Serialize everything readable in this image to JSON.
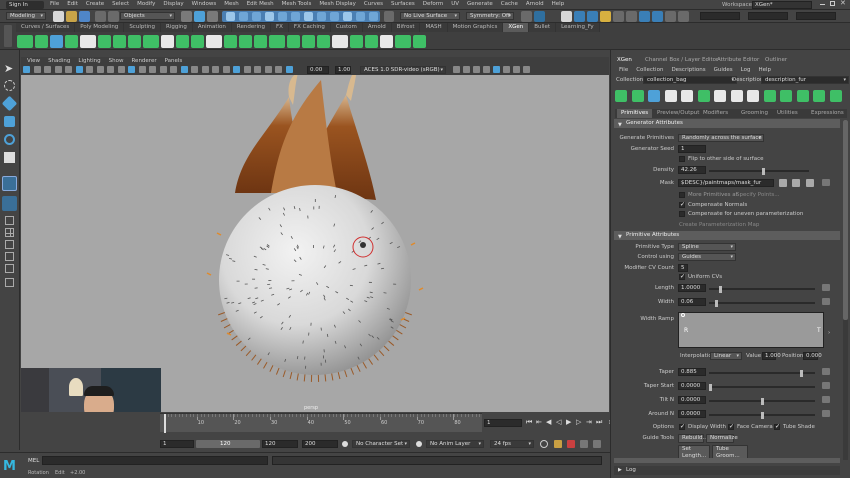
{
  "menubar": {
    "signin": "Sign In",
    "items": [
      "File",
      "Edit",
      "Create",
      "Select",
      "Modify",
      "Display",
      "Windows",
      "Mesh",
      "Edit Mesh",
      "Mesh Tools",
      "Mesh Display",
      "Curves",
      "Surfaces",
      "Deform",
      "UV",
      "Generate",
      "Cache",
      "Arnold",
      "Help"
    ],
    "workspace_label": "Workspace :",
    "workspace_value": "XGen*"
  },
  "statusline": {
    "mode": "Modeling",
    "select_mode": "Objects",
    "live_surface": "No Live Surface",
    "symmetry": "Symmetry: Off"
  },
  "shelf": {
    "tabs": [
      "Curves / Surfaces",
      "Poly Modeling",
      "Sculpting",
      "Rigging",
      "Animation",
      "Rendering",
      "FX",
      "FX Caching",
      "Custom",
      "Arnold",
      "Bifrost",
      "MASH",
      "Motion Graphics",
      "XGen",
      "Bullet",
      "Learning_Fy"
    ],
    "active": "XGen"
  },
  "viewport": {
    "menu": [
      "View",
      "Shading",
      "Lighting",
      "Show",
      "Renderer",
      "Panels"
    ],
    "near": "0.00",
    "far": "1.00",
    "colorspace": "ACES 1.0 SDR-video (sRGB)",
    "camera_label": "persp"
  },
  "timeline": {
    "ticks": [
      "10",
      "20",
      "30",
      "40",
      "50",
      "60",
      "70",
      "80",
      "90",
      "100",
      "110",
      "120"
    ],
    "current_frame": "1",
    "range_start_a": "1",
    "range_start_b": "1",
    "range_end_a": "120",
    "range_end_b": "120",
    "range_end_c": "200",
    "character_set": "No Character Set",
    "anim_layer": "No Anim Layer",
    "fps": "24 fps"
  },
  "commandline": {
    "label": "MEL",
    "help_a": "Rotation",
    "help_b": "Edit",
    "help_c": "+2.00"
  },
  "right_panel": {
    "tabs": [
      "XGen",
      "Channel Box / Layer Editor",
      "Attribute Editor",
      "Outliner"
    ],
    "menu": [
      "File",
      "Collection",
      "Descriptions",
      "Guides",
      "Log",
      "Help"
    ],
    "collection_label": "Collection",
    "collection_value": "collection_bag",
    "description_label": "Description",
    "description_value": "description_fur",
    "subtabs": [
      "Primitives",
      "Preview/Output",
      "Modifiers",
      "Grooming",
      "Utilities",
      "Expressions"
    ],
    "active_subtab": "Primitives",
    "gen_section": "Generator Attributes",
    "generate_primitives_label": "Generate Primitives",
    "generate_primitives_value": "Randomly across the surface",
    "generator_seed_label": "Generator Seed",
    "generator_seed_value": "1",
    "flip_label": "Flip to other side of surface",
    "density_label": "Density",
    "density_value": "42.26",
    "density_level": 0.55,
    "mask_label": "Mask",
    "mask_value": "$DESC}/paintmaps/mask_fur",
    "more_prims_label": "More Primitives at",
    "specify_points_label": "Specify Points...",
    "compensate_normals_label": "Compensate Normals",
    "compensate_uneven_label": "Compensate for uneven parameterization",
    "create_param_map": "Create Parameterization Map",
    "prim_section": "Primitive Attributes",
    "primitive_type_label": "Primitive Type",
    "primitive_type_value": "Spline",
    "control_using_label": "Control using",
    "control_using_value": "Guides",
    "modifier_cv_label": "Modifier CV Count",
    "modifier_cv_value": "5",
    "uniform_cvs_label": "Uniform CVs",
    "length_label": "Length",
    "length_value": "1.0000",
    "length_level": 0.1,
    "width_label": "Width",
    "width_value": "0.06",
    "width_level": 0.06,
    "width_ramp_label": "Width Ramp",
    "ramp_left": "R",
    "ramp_right": "T",
    "interpolation_label": "Interpolation",
    "interpolation_value": "Linear",
    "value_label": "Value",
    "value_value": "1.000",
    "position_label": "Position",
    "position_value": "0.000",
    "taper_label": "Taper",
    "taper_value": "0.885",
    "taper_level": 0.88,
    "taper_start_label": "Taper Start",
    "taper_start_value": "0.0000",
    "taper_start_level": 0.0,
    "tilt_n_label": "Tilt N",
    "tilt_n_value": "0.0000",
    "tilt_n_level": 0.5,
    "around_n_label": "Around N",
    "around_n_value": "0.0000",
    "around_n_level": 0.5,
    "options_label": "Options",
    "display_width_label": "Display Width",
    "face_camera_label": "Face Camera",
    "tube_shade_label": "Tube Shade",
    "guide_tools_label": "Guide Tools",
    "rebuild_label": "Rebuild...",
    "normalize_label": "Normalize",
    "set_length_label": "Set Length...",
    "tube_groom_label": "Tube Groom...",
    "log_label": "Log"
  },
  "colors": {
    "viewport_bg": "#a7a7a7",
    "accent_blue": "#4ea1d8",
    "fur_brown": "#8a4a1c",
    "xgen_green": "#3fbf66",
    "active_tab": "#5b5b5b"
  }
}
